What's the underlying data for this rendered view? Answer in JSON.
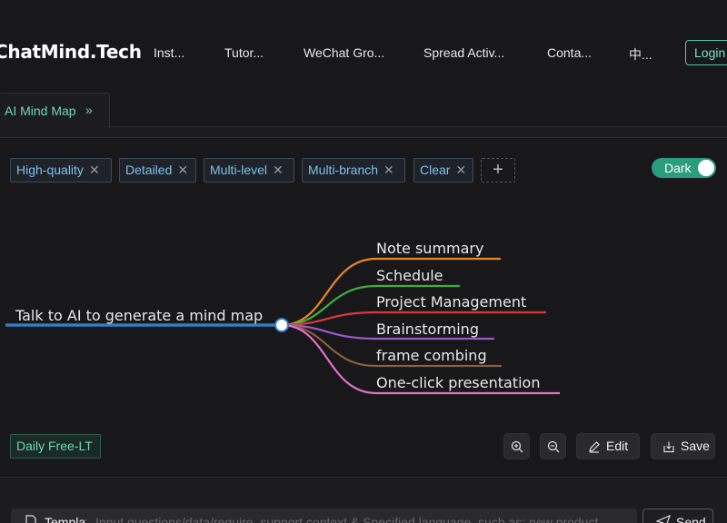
{
  "header": {
    "logo": "ChatMind.Tech",
    "nav": [
      "Inst...",
      "Tutor...",
      "WeChat Gro...",
      "Spread Activ...",
      "Conta...",
      "中..."
    ],
    "login": "Login"
  },
  "tabs": [
    {
      "label": "AI Mind Map",
      "icon": "double-chevron-right-icon"
    }
  ],
  "tags": [
    "High-quality",
    "Detailed",
    "Multi-level",
    "Multi-branch",
    "Clear"
  ],
  "theme_toggle": {
    "label": "Dark",
    "on": true
  },
  "mindmap": {
    "root": "Talk to AI to generate a mind map",
    "branches": [
      {
        "label": "Note summary",
        "color": "#e8852a"
      },
      {
        "label": "Schedule",
        "color": "#3eae3e"
      },
      {
        "label": "Project Management",
        "color": "#d63a3a"
      },
      {
        "label": "Brainstorming",
        "color": "#9b59c9"
      },
      {
        "label": "frame combing",
        "color": "#8b5e3c"
      },
      {
        "label": "One-click presentation",
        "color": "#e46fc9"
      }
    ],
    "root_color": "#2f7fc4"
  },
  "badge": "Daily Free-LT",
  "toolbar": {
    "zoom_in_icon": "zoom-in-icon",
    "zoom_out_icon": "zoom-out-icon",
    "edit": "Edit",
    "save": "Save"
  },
  "composer": {
    "template_label": "Templates",
    "placeholder": "Input questions/data/require, support context & Specified language, such as: new product",
    "send": "Send"
  }
}
